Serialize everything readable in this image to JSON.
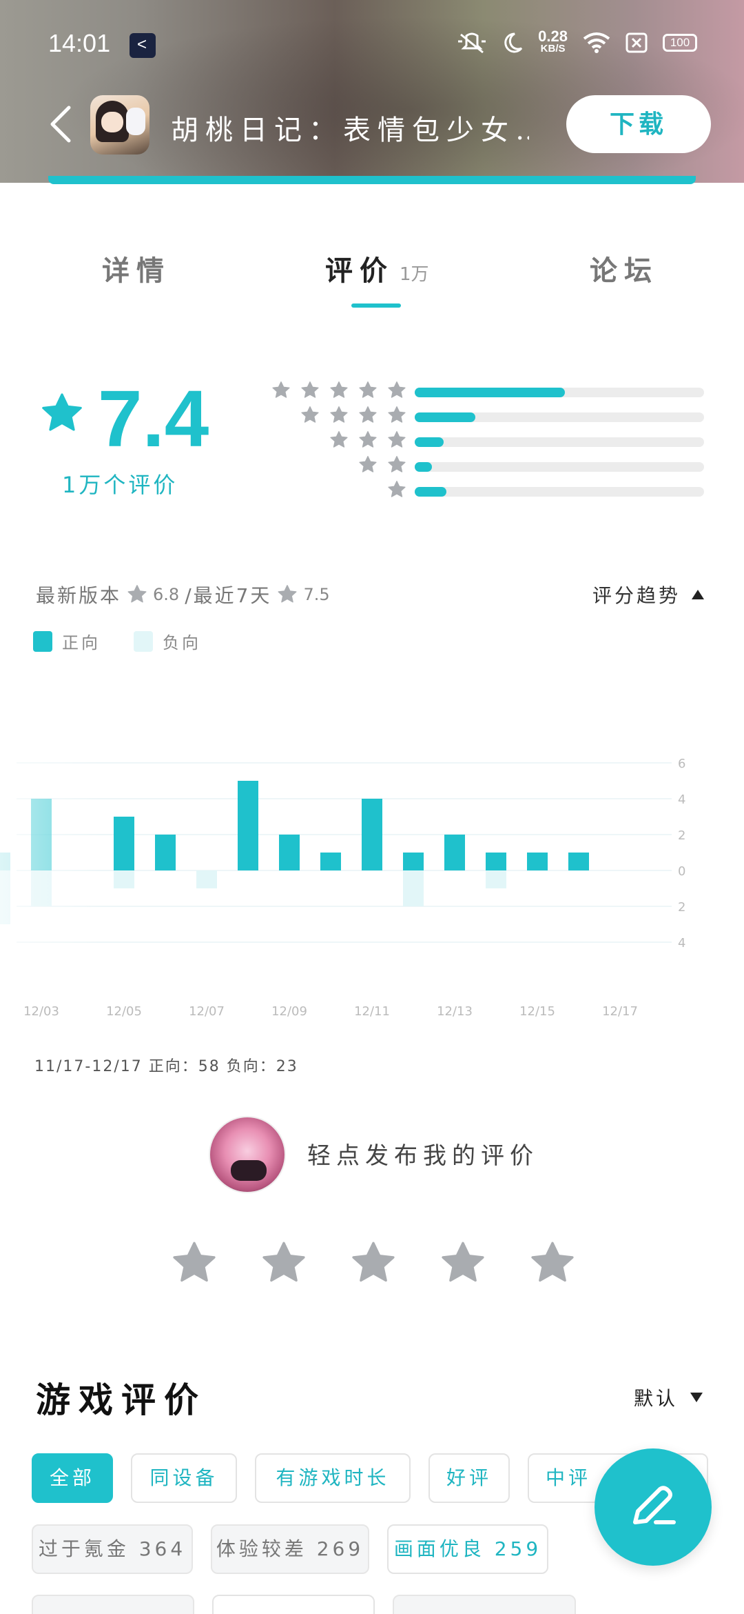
{
  "status_bar": {
    "time": "14:01",
    "net_speed": "0.28",
    "net_unit": "KB/S",
    "battery": "100"
  },
  "header": {
    "app_name": "胡桃日记：表情包少女…",
    "download_label": "下载"
  },
  "tabs": [
    {
      "label": "详情"
    },
    {
      "label": "评价",
      "count": "1万"
    },
    {
      "label": "论坛"
    }
  ],
  "rating": {
    "score": "7.4",
    "count_label": "1万个评价",
    "distribution": [
      {
        "stars": 5,
        "fraction": 0.52
      },
      {
        "stars": 4,
        "fraction": 0.21
      },
      {
        "stars": 3,
        "fraction": 0.1
      },
      {
        "stars": 2,
        "fraction": 0.06
      },
      {
        "stars": 1,
        "fraction": 0.11
      }
    ]
  },
  "trend": {
    "latest_label": "最新版本",
    "latest_score": "6.8",
    "recent_label": "/最近7天",
    "recent_score": "7.5",
    "toggle_label": "评分趋势",
    "legend_positive": "正向",
    "legend_negative": "负向",
    "footer": "11/17-12/17  正向：58  负向：23"
  },
  "chart_data": {
    "type": "bar",
    "x": [
      "12/02",
      "12/03",
      "12/04",
      "12/05",
      "12/06",
      "12/07",
      "12/08",
      "12/09",
      "12/10",
      "12/11",
      "12/12",
      "12/13",
      "12/14",
      "12/15",
      "12/16",
      "12/17"
    ],
    "x_tick_labels": [
      "12/03",
      "12/05",
      "12/07",
      "12/09",
      "12/11",
      "12/13",
      "12/15",
      "12/17"
    ],
    "series": [
      {
        "name": "正向",
        "values": [
          1,
          4,
          0,
          3,
          2,
          0,
          5,
          2,
          1,
          4,
          1,
          2,
          1,
          1,
          1,
          0
        ]
      },
      {
        "name": "负向",
        "values": [
          3,
          2,
          0,
          1,
          0,
          1,
          0,
          0,
          0,
          0,
          2,
          0,
          1,
          0,
          0,
          0
        ]
      }
    ],
    "y_ticks": [
      "6",
      "4",
      "2",
      "0",
      "2",
      "4"
    ],
    "ylim": [
      -4,
      6
    ],
    "colors": {
      "positive": "#1fc1cc",
      "negative": "#e2f6f8",
      "grid": "#eef6f8"
    }
  },
  "post_review": {
    "prompt": "轻点发布我的评价"
  },
  "reviews": {
    "title": "游戏评价",
    "sort_label": "默认",
    "filters_row1": [
      "全部",
      "同设备",
      "有游戏时长",
      "好评",
      "中评"
    ],
    "filters_row2": [
      "过于氪金 364",
      "体验较差 269",
      "画面优良 259"
    ]
  },
  "colors": {
    "accent": "#1fc1cc",
    "star_gray": "#a9acb0"
  }
}
